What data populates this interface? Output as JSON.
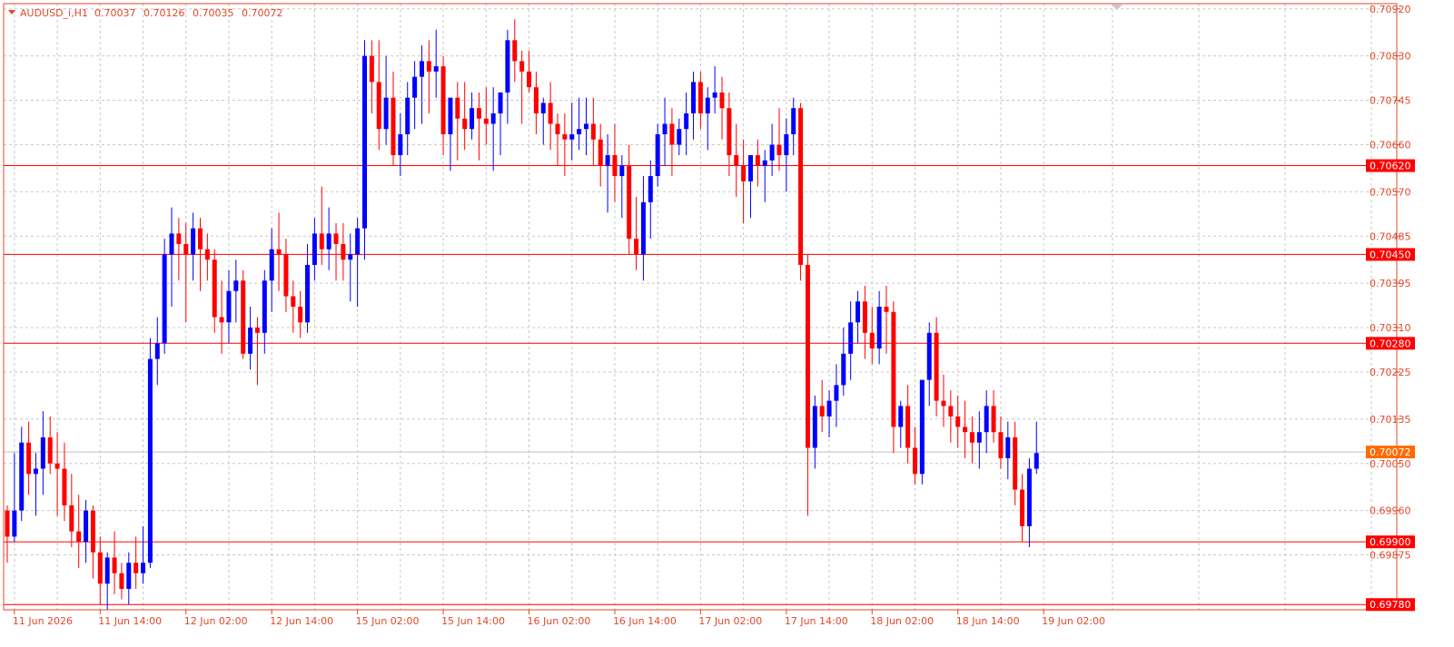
{
  "chart_data": {
    "type": "candlestick",
    "symbol": "AUDUSD_i,H1",
    "ohlc_readout": [
      "0.70037",
      "0.70126",
      "0.70035",
      "0.70072"
    ],
    "ylim": [
      0.6977,
      0.7093
    ],
    "y_ticks": [
      "0.70920",
      "0.70830",
      "0.70745",
      "0.70660",
      "0.70570",
      "0.70485",
      "0.70395",
      "0.70310",
      "0.70225",
      "0.70135",
      "0.70050",
      "0.69960",
      "0.69875"
    ],
    "x_ticks": [
      {
        "i": 1,
        "label": "11 Jun 2026"
      },
      {
        "i": 13,
        "label": "11 Jun 14:00"
      },
      {
        "i": 25,
        "label": "12 Jun 02:00"
      },
      {
        "i": 37,
        "label": "12 Jun 14:00"
      },
      {
        "i": 49,
        "label": "15 Jun 02:00"
      },
      {
        "i": 61,
        "label": "15 Jun 14:00"
      },
      {
        "i": 73,
        "label": "16 Jun 02:00"
      },
      {
        "i": 85,
        "label": "16 Jun 14:00"
      },
      {
        "i": 97,
        "label": "17 Jun 02:00"
      },
      {
        "i": 109,
        "label": "17 Jun 14:00"
      },
      {
        "i": 121,
        "label": "18 Jun 02:00"
      },
      {
        "i": 133,
        "label": "18 Jun 14:00"
      },
      {
        "i": 145,
        "label": "19 Jun 02:00"
      }
    ],
    "horizontal_levels": [
      "0.70620",
      "0.70450",
      "0.70280",
      "0.69900",
      "0.69780"
    ],
    "current_price": "0.70072",
    "candles": [
      [
        0.6996,
        0.6997,
        0.6986,
        0.6991
      ],
      [
        0.6991,
        0.7007,
        0.699,
        0.6996
      ],
      [
        0.6996,
        0.7012,
        0.6994,
        0.7009
      ],
      [
        0.7009,
        0.7013,
        0.6999,
        0.7003
      ],
      [
        0.7003,
        0.7007,
        0.6995,
        0.7004
      ],
      [
        0.7004,
        0.7015,
        0.6999,
        0.701
      ],
      [
        0.701,
        0.7014,
        0.7003,
        0.7005
      ],
      [
        0.7005,
        0.7011,
        0.6995,
        0.7004
      ],
      [
        0.7004,
        0.7009,
        0.6994,
        0.6997
      ],
      [
        0.6997,
        0.7003,
        0.6989,
        0.6992
      ],
      [
        0.6992,
        0.6999,
        0.6985,
        0.699
      ],
      [
        0.699,
        0.6998,
        0.6986,
        0.6996
      ],
      [
        0.6996,
        0.6997,
        0.6983,
        0.6988
      ],
      [
        0.6988,
        0.6991,
        0.6978,
        0.6982
      ],
      [
        0.6982,
        0.6988,
        0.6977,
        0.6987
      ],
      [
        0.6987,
        0.6992,
        0.698,
        0.6984
      ],
      [
        0.6984,
        0.6986,
        0.6979,
        0.6981
      ],
      [
        0.6981,
        0.6988,
        0.6978,
        0.6986
      ],
      [
        0.6986,
        0.6991,
        0.6981,
        0.6984
      ],
      [
        0.6984,
        0.6993,
        0.6982,
        0.6986
      ],
      [
        0.6986,
        0.7029,
        0.6985,
        0.7025
      ],
      [
        0.7025,
        0.7033,
        0.702,
        0.7028
      ],
      [
        0.7028,
        0.7048,
        0.7026,
        0.7045
      ],
      [
        0.7045,
        0.7054,
        0.7035,
        0.7049
      ],
      [
        0.7049,
        0.7052,
        0.704,
        0.7047
      ],
      [
        0.7047,
        0.7051,
        0.7032,
        0.7045
      ],
      [
        0.7045,
        0.7053,
        0.704,
        0.705
      ],
      [
        0.705,
        0.7052,
        0.7038,
        0.7046
      ],
      [
        0.7046,
        0.7049,
        0.704,
        0.7044
      ],
      [
        0.7044,
        0.7046,
        0.703,
        0.7033
      ],
      [
        0.7033,
        0.704,
        0.7026,
        0.7032
      ],
      [
        0.7032,
        0.7042,
        0.7028,
        0.7038
      ],
      [
        0.7038,
        0.7044,
        0.7032,
        0.704
      ],
      [
        0.704,
        0.7042,
        0.7025,
        0.7026
      ],
      [
        0.7026,
        0.7035,
        0.7023,
        0.7031
      ],
      [
        0.7031,
        0.7033,
        0.702,
        0.703
      ],
      [
        0.703,
        0.7042,
        0.7026,
        0.704
      ],
      [
        0.704,
        0.705,
        0.7034,
        0.7046
      ],
      [
        0.7046,
        0.7053,
        0.7038,
        0.7045
      ],
      [
        0.7045,
        0.7048,
        0.7034,
        0.7037
      ],
      [
        0.7037,
        0.704,
        0.703,
        0.7035
      ],
      [
        0.7035,
        0.7038,
        0.7029,
        0.7032
      ],
      [
        0.7032,
        0.7047,
        0.703,
        0.7043
      ],
      [
        0.7043,
        0.7052,
        0.704,
        0.7049
      ],
      [
        0.7049,
        0.7058,
        0.7043,
        0.7046
      ],
      [
        0.7046,
        0.7054,
        0.7042,
        0.7049
      ],
      [
        0.7049,
        0.7051,
        0.704,
        0.7047
      ],
      [
        0.7047,
        0.7051,
        0.704,
        0.7044
      ],
      [
        0.7044,
        0.7049,
        0.7036,
        0.7045
      ],
      [
        0.7045,
        0.7052,
        0.7035,
        0.705
      ],
      [
        0.705,
        0.7086,
        0.7044,
        0.7083
      ],
      [
        0.7083,
        0.7086,
        0.7072,
        0.7078
      ],
      [
        0.7078,
        0.7086,
        0.7065,
        0.7069
      ],
      [
        0.7069,
        0.7083,
        0.7066,
        0.7075
      ],
      [
        0.7075,
        0.708,
        0.7062,
        0.7064
      ],
      [
        0.7064,
        0.7072,
        0.706,
        0.7068
      ],
      [
        0.7068,
        0.7078,
        0.7064,
        0.7075
      ],
      [
        0.7075,
        0.7082,
        0.7069,
        0.7079
      ],
      [
        0.7079,
        0.7085,
        0.707,
        0.7082
      ],
      [
        0.7082,
        0.7086,
        0.7072,
        0.708
      ],
      [
        0.708,
        0.7088,
        0.7075,
        0.7081
      ],
      [
        0.7081,
        0.7083,
        0.7064,
        0.7068
      ],
      [
        0.7068,
        0.7072,
        0.7061,
        0.7075
      ],
      [
        0.7075,
        0.7078,
        0.7063,
        0.7071
      ],
      [
        0.7071,
        0.7078,
        0.7065,
        0.7069
      ],
      [
        0.7069,
        0.7076,
        0.7067,
        0.7073
      ],
      [
        0.7073,
        0.7076,
        0.7063,
        0.7071
      ],
      [
        0.7071,
        0.7077,
        0.7066,
        0.707
      ],
      [
        0.707,
        0.7077,
        0.7061,
        0.7072
      ],
      [
        0.7072,
        0.7075,
        0.7064,
        0.7076
      ],
      [
        0.7076,
        0.7088,
        0.707,
        0.7086
      ],
      [
        0.7086,
        0.709,
        0.7078,
        0.7082
      ],
      [
        0.7082,
        0.7084,
        0.707,
        0.708
      ],
      [
        0.708,
        0.7084,
        0.7076,
        0.7077
      ],
      [
        0.7077,
        0.708,
        0.7068,
        0.7072
      ],
      [
        0.7072,
        0.7075,
        0.7066,
        0.7074
      ],
      [
        0.7074,
        0.7078,
        0.7065,
        0.707
      ],
      [
        0.707,
        0.7072,
        0.7062,
        0.7068
      ],
      [
        0.7068,
        0.7072,
        0.706,
        0.7067
      ],
      [
        0.7067,
        0.7074,
        0.7063,
        0.7068
      ],
      [
        0.7068,
        0.7075,
        0.7065,
        0.7069
      ],
      [
        0.7069,
        0.7075,
        0.7064,
        0.707
      ],
      [
        0.707,
        0.7075,
        0.7062,
        0.7067
      ],
      [
        0.7067,
        0.707,
        0.7058,
        0.7062
      ],
      [
        0.7062,
        0.7068,
        0.7053,
        0.7064
      ],
      [
        0.7064,
        0.707,
        0.7055,
        0.706
      ],
      [
        0.706,
        0.7064,
        0.7052,
        0.7062
      ],
      [
        0.7062,
        0.7066,
        0.7045,
        0.7048
      ],
      [
        0.7048,
        0.7056,
        0.7042,
        0.7045
      ],
      [
        0.7045,
        0.706,
        0.704,
        0.7055
      ],
      [
        0.7055,
        0.7063,
        0.7048,
        0.706
      ],
      [
        0.706,
        0.707,
        0.7058,
        0.7068
      ],
      [
        0.7068,
        0.7075,
        0.7062,
        0.707
      ],
      [
        0.707,
        0.7073,
        0.706,
        0.7066
      ],
      [
        0.7066,
        0.7071,
        0.7064,
        0.7069
      ],
      [
        0.7069,
        0.7076,
        0.7064,
        0.7072
      ],
      [
        0.7072,
        0.708,
        0.7067,
        0.7078
      ],
      [
        0.7078,
        0.708,
        0.7069,
        0.7072
      ],
      [
        0.7072,
        0.7077,
        0.7065,
        0.7075
      ],
      [
        0.7075,
        0.7081,
        0.7072,
        0.7076
      ],
      [
        0.7076,
        0.7079,
        0.7067,
        0.7073
      ],
      [
        0.7073,
        0.7076,
        0.706,
        0.7064
      ],
      [
        0.7064,
        0.707,
        0.7056,
        0.7062
      ],
      [
        0.7062,
        0.7067,
        0.7051,
        0.7059
      ],
      [
        0.7059,
        0.7064,
        0.7052,
        0.7064
      ],
      [
        0.7064,
        0.7067,
        0.7058,
        0.7062
      ],
      [
        0.7062,
        0.7065,
        0.7055,
        0.7063
      ],
      [
        0.7063,
        0.707,
        0.706,
        0.7066
      ],
      [
        0.7066,
        0.7073,
        0.7061,
        0.7064
      ],
      [
        0.7064,
        0.7071,
        0.7057,
        0.7068
      ],
      [
        0.7068,
        0.7075,
        0.7064,
        0.7073
      ],
      [
        0.7073,
        0.7074,
        0.704,
        0.7043
      ],
      [
        0.7043,
        0.7045,
        0.6995,
        0.7008
      ],
      [
        0.7008,
        0.7018,
        0.7004,
        0.7016
      ],
      [
        0.7016,
        0.7021,
        0.7011,
        0.7014
      ],
      [
        0.7014,
        0.7019,
        0.701,
        0.7017
      ],
      [
        0.7017,
        0.7024,
        0.7012,
        0.702
      ],
      [
        0.702,
        0.7031,
        0.7018,
        0.7026
      ],
      [
        0.7026,
        0.7036,
        0.7021,
        0.7032
      ],
      [
        0.7032,
        0.7038,
        0.7028,
        0.7036
      ],
      [
        0.7036,
        0.7039,
        0.7025,
        0.703
      ],
      [
        0.703,
        0.7035,
        0.7024,
        0.7027
      ],
      [
        0.7027,
        0.7038,
        0.7024,
        0.7035
      ],
      [
        0.7035,
        0.7039,
        0.7026,
        0.7034
      ],
      [
        0.7034,
        0.7036,
        0.7007,
        0.7012
      ],
      [
        0.7012,
        0.7017,
        0.7008,
        0.7016
      ],
      [
        0.7016,
        0.702,
        0.7005,
        0.7008
      ],
      [
        0.7008,
        0.7012,
        0.7001,
        0.7003
      ],
      [
        0.7003,
        0.7021,
        0.7001,
        0.7021
      ],
      [
        0.7021,
        0.7032,
        0.7016,
        0.703
      ],
      [
        0.703,
        0.7033,
        0.7014,
        0.7017
      ],
      [
        0.7017,
        0.7022,
        0.7012,
        0.7016
      ],
      [
        0.7016,
        0.7019,
        0.7009,
        0.7014
      ],
      [
        0.7014,
        0.7018,
        0.7008,
        0.7012
      ],
      [
        0.7012,
        0.7017,
        0.7006,
        0.7011
      ],
      [
        0.7011,
        0.7014,
        0.7005,
        0.7009
      ],
      [
        0.7009,
        0.7015,
        0.7004,
        0.7011
      ],
      [
        0.7011,
        0.7019,
        0.7007,
        0.7016
      ],
      [
        0.7016,
        0.7019,
        0.7009,
        0.7011
      ],
      [
        0.7011,
        0.7014,
        0.7004,
        0.7006
      ],
      [
        0.7006,
        0.7013,
        0.7002,
        0.701
      ],
      [
        0.701,
        0.7013,
        0.6997,
        0.7
      ],
      [
        0.7,
        0.7003,
        0.699,
        0.6993
      ],
      [
        0.6993,
        0.7006,
        0.6989,
        0.7004
      ],
      [
        0.7004,
        0.7013,
        0.7003,
        0.7007
      ]
    ]
  }
}
